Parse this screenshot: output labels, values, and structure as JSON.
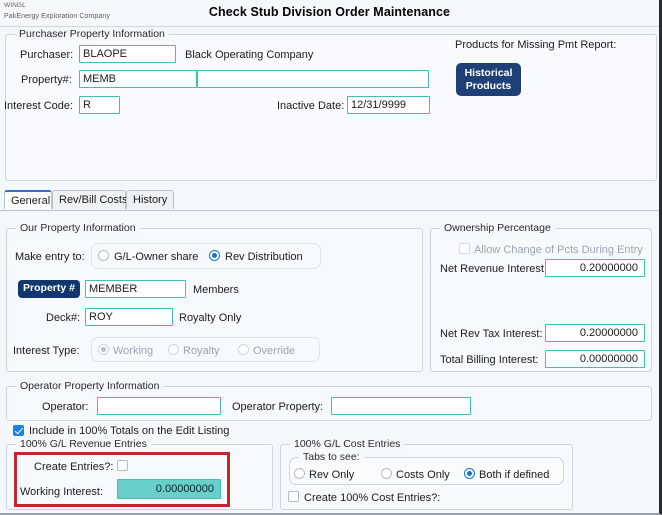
{
  "window": {
    "company_code": "WINGL",
    "company_name": "PakEnergy Exploration Company",
    "title": "Check Stub Division Order Maintenance"
  },
  "purchaser_section": {
    "legend": "Purchaser Property Information",
    "purchaser_label": "Purchaser:",
    "purchaser_value": "BLAOPE",
    "purchaser_name": "Black Operating Company",
    "property_label": "Property#:",
    "property_value": "MEMB",
    "property_desc_value": "",
    "interest_code_label": "Interest Code:",
    "interest_code_value": "R",
    "inactive_date_label": "Inactive Date:",
    "inactive_date_value": "12/31/9999",
    "products_label": "Products for Missing Pmt Report:",
    "historical_button_line1": "Historical",
    "historical_button_line2": "Products"
  },
  "tabs": [
    {
      "label": "General",
      "active": true
    },
    {
      "label": "Rev/Bill Costs",
      "active": false
    },
    {
      "label": "History",
      "active": false
    }
  ],
  "our_property": {
    "legend": "Our Property Information",
    "make_entry_label": "Make entry to:",
    "radio_gl_owner": "G/L-Owner share",
    "radio_rev_dist": "Rev Distribution",
    "property_badge": "Property #",
    "property_value": "MEMBER",
    "property_desc": "Members",
    "deck_label": "Deck#:",
    "deck_value": "ROY",
    "deck_desc": "Royalty Only",
    "interest_type_label": "Interest Type:",
    "interest_working": "Working",
    "interest_royalty": "Royalty",
    "interest_override": "Override"
  },
  "ownership": {
    "legend": "Ownership Percentage",
    "allow_change_label": "Allow Change of Pcts During Entry",
    "net_revenue_label": "Net Revenue Interest:",
    "net_revenue_value": "0.20000000",
    "net_rev_tax_label": "Net Rev Tax Interest:",
    "net_rev_tax_value": "0.20000000",
    "total_billing_label": "Total Billing Interest:",
    "total_billing_value": "0.00000000"
  },
  "operator": {
    "legend": "Operator Property Information",
    "operator_label": "Operator:",
    "operator_value": "",
    "operator_property_label": "Operator Property:",
    "operator_property_value": ""
  },
  "include_totals_label": "Include in 100% Totals on the Edit Listing",
  "revenue_entries": {
    "legend": "100% G/L Revenue Entries",
    "create_entries_label": "Create Entries?:",
    "working_interest_label": "Working Interest:",
    "working_interest_value": "0.00000000"
  },
  "cost_entries": {
    "legend": "100% G/L Cost Entries",
    "tabs_to_see_label": "Tabs to see:",
    "rev_only": "Rev Only",
    "costs_only": "Costs Only",
    "both_if_defined": "Both if defined",
    "create_cost_entries_label": "Create 100% Cost Entries?:"
  },
  "colors": {
    "accent_navy": "#1f3f77",
    "field_border_teal": "#3fc1b0",
    "field_fill_teal": "#68cfc9",
    "highlight_red": "#c1272d",
    "radio_blue": "#1373d6"
  }
}
